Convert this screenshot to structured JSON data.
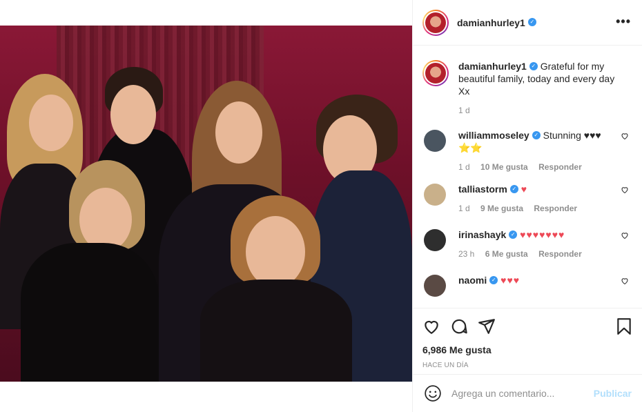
{
  "post": {
    "username": "damianhurley1",
    "caption": "Grateful for my beautiful family, today and every day Xx",
    "caption_time": "1 d",
    "likes": "6,986 Me gusta",
    "posted_ago": "HACE UN DÍA"
  },
  "comments": [
    {
      "user": "williammoseley",
      "text": "Stunning ♥♥♥",
      "extra": "⭐⭐",
      "time": "1 d",
      "likes": "10 Me gusta",
      "reply": "Responder",
      "avatar_color": "#4a5560"
    },
    {
      "user": "talliastorm",
      "text": "",
      "hearts": "♥",
      "time": "1 d",
      "likes": "9 Me gusta",
      "reply": "Responder",
      "avatar_color": "#c9b08a"
    },
    {
      "user": "irinashayk",
      "text": "",
      "hearts": "♥♥♥♥♥♥♥",
      "time": "23 h",
      "likes": "6 Me gusta",
      "reply": "Responder",
      "avatar_color": "#2e2e2e"
    },
    {
      "user": "naomi",
      "text": "",
      "hearts": "♥♥♥",
      "avatar_color": "#5a4a44"
    }
  ],
  "add_comment": {
    "placeholder": "Agrega un comentario...",
    "publish": "Publicar"
  },
  "colors": {
    "verified": "#3897f0",
    "heart": "#ed4956",
    "muted": "#8e8e8e",
    "publish_disabled": "#b2dffc"
  },
  "icons": [
    "more-icon",
    "verified-icon",
    "heart-icon",
    "comment-icon",
    "share-icon",
    "bookmark-icon",
    "emoji-icon"
  ]
}
